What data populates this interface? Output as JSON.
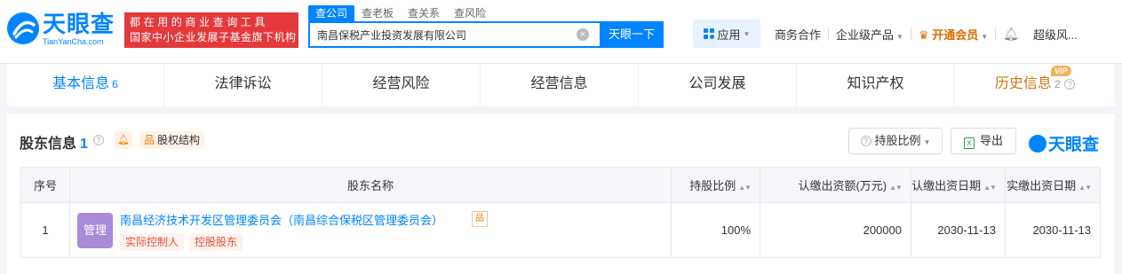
{
  "header": {
    "logo_text": "天眼查",
    "logo_sub": "TianYanCha.com",
    "slogan_line1": "都在用的商业查询工具",
    "slogan_line2": "国家中小企业发展子基金旗下机构",
    "search_tabs": [
      "查公司",
      "查老板",
      "查关系",
      "查风险"
    ],
    "search_value": "南昌保税产业投资发展有限公司",
    "search_button": "天眼一下",
    "app_label": "应用",
    "business": "商务合作",
    "enterprise": "企业级产品",
    "vip": "开通会员",
    "user": "超级风..."
  },
  "tabs": [
    {
      "label": "基本信息",
      "count": "6"
    },
    {
      "label": "法律诉讼",
      "count": ""
    },
    {
      "label": "经营风险",
      "count": ""
    },
    {
      "label": "经营信息",
      "count": ""
    },
    {
      "label": "公司发展",
      "count": ""
    },
    {
      "label": "知识产权",
      "count": ""
    },
    {
      "label": "历史信息",
      "count": "2",
      "badge": "VIP"
    }
  ],
  "section": {
    "title": "股东信息",
    "count": "1",
    "equity_structure": "股权结构",
    "ratio_button": "持股比例",
    "export_button": "导出",
    "watermark": "天眼查"
  },
  "table": {
    "headers": [
      "序号",
      "股东名称",
      "持股比例",
      "认缴出资额(万元)",
      "认缴出资日期",
      "实缴出资日期"
    ],
    "rows": [
      {
        "index": "1",
        "avatar": "管理",
        "name": "南昌经济技术开发区管理委员会（南昌综合保税区管理委员会）",
        "tags": [
          "实际控制人",
          "控股股东"
        ],
        "ratio": "100%",
        "amount": "200000",
        "subscribed_date": "2030-11-13",
        "paid_date": "2030-11-13"
      }
    ]
  },
  "colors": {
    "brand": "#0084ff",
    "red": "#e4393c",
    "vip": "#d96d00",
    "avatar": "#a98bd8"
  }
}
